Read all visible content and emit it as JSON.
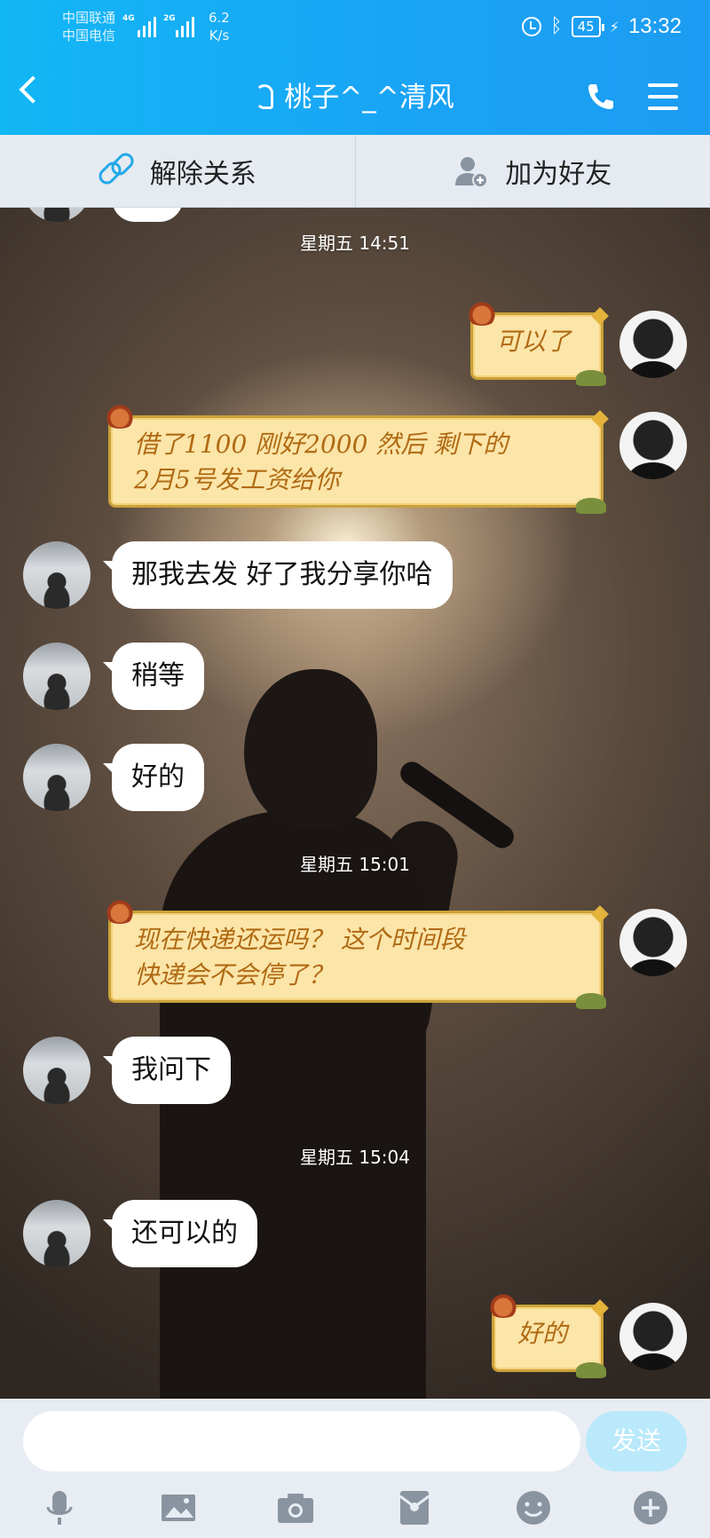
{
  "status_bar": {
    "carrier_1": "中国联通",
    "carrier_2": "中国电信",
    "net_1": "4G",
    "net_2": "2G",
    "speed_value": "6.2",
    "speed_unit": "K/s",
    "battery": "45",
    "time": "13:32"
  },
  "header": {
    "title": "桃子^_^清风"
  },
  "action_bar": {
    "unlink_label": "解除关系",
    "add_friend_label": "加为好友"
  },
  "chat": {
    "timestamps": [
      "星期五 14:51",
      "星期五 15:01",
      "星期五 15:04"
    ],
    "messages": [
      {
        "from": "me",
        "style": "sticker",
        "text": "可以了"
      },
      {
        "from": "me",
        "style": "sticker",
        "text_line1": "借了1100 刚好2000 然后 剩下的",
        "text_line2": "2月5号发工资给你"
      },
      {
        "from": "friend",
        "style": "plain",
        "text": "那我去发 好了我分享你哈"
      },
      {
        "from": "friend",
        "style": "plain",
        "text": "稍等"
      },
      {
        "from": "friend",
        "style": "plain",
        "text": "好的"
      },
      {
        "from": "me",
        "style": "sticker",
        "text_line1": "现在快递还运吗？ 这个时间段",
        "text_line2": "快递会不会停了？"
      },
      {
        "from": "friend",
        "style": "plain",
        "text": "我问下"
      },
      {
        "from": "friend",
        "style": "plain",
        "text": "还可以的"
      },
      {
        "from": "me",
        "style": "sticker",
        "text": "好的"
      }
    ]
  },
  "input_bar": {
    "input_value": "",
    "send_label": "发送"
  },
  "colors": {
    "header_blue": "#12b7f5",
    "accent_link": "#22a9e9",
    "sticker_bg": "#fbe5a8",
    "sticker_text": "#b06a14",
    "send_disabled": "#b9e9fb"
  },
  "icons": {
    "toolbar": [
      "microphone-icon",
      "picture-icon",
      "camera-icon",
      "red-packet-icon",
      "emoji-icon",
      "plus-icon"
    ]
  }
}
